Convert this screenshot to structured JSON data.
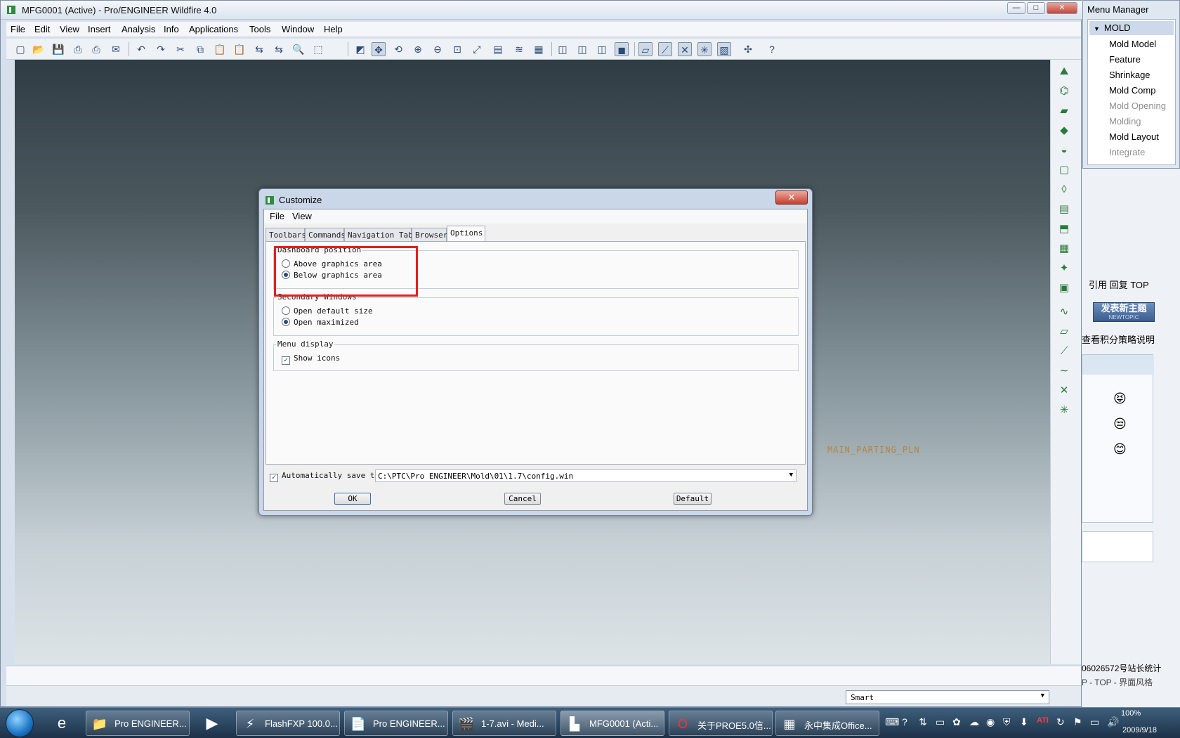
{
  "window": {
    "title": "MFG0001 (Active) - Pro/ENGINEER Wildfire 4.0",
    "controls": [
      "—",
      "□",
      "✕"
    ]
  },
  "menubar": [
    "File",
    "Edit",
    "View",
    "Insert",
    "Analysis",
    "Info",
    "Applications",
    "Tools",
    "Window",
    "Help"
  ],
  "toolbar_icons": [
    "new-icon",
    "open-icon",
    "save-icon",
    "print-icon",
    "quick-print-icon",
    "send-icon",
    "undo-icon",
    "redo-icon",
    "cut-icon",
    "copy-icon",
    "paste-icon",
    "paste-special-icon",
    "regenerate-icon",
    "regen-manager-icon",
    "find-icon",
    "select-box-icon",
    "repaint-icon",
    "spin-center-icon",
    "orient-icon",
    "zoom-in-icon",
    "zoom-out-icon",
    "refit-icon",
    "reorient-icon",
    "saved-views-icon",
    "layers-icon",
    "view-manager-icon",
    "wireframe-icon",
    "hidden-line-icon",
    "no-hidden-icon",
    "shading-icon",
    "datum-planes-icon",
    "datum-axes-icon",
    "datum-points-icon",
    "coord-sys-icon",
    "annotations-icon",
    "spin-center-toggle-icon",
    "context-help-icon"
  ],
  "graphics": {
    "datum_label": "MAIN_PARTING_PLN"
  },
  "right_toolbar_icons": [
    "mold-volume-icon",
    "parting-surface-icon",
    "extrude-icon",
    "sweep-icon",
    "revolve-icon",
    "datum-plane-icon",
    "sketch-icon",
    "split-icon",
    "cavity-icon",
    "trim-icon",
    "merge-icon",
    "waterline-icon",
    "plane-icon",
    "axis-icon",
    "curve-icon",
    "point-icon",
    "csys-icon",
    "analysis-icon"
  ],
  "menu_manager": {
    "title": "Menu Manager",
    "header": "MOLD",
    "items": [
      {
        "label": "Mold Model",
        "enabled": true
      },
      {
        "label": "Feature",
        "enabled": true
      },
      {
        "label": "Shrinkage",
        "enabled": true
      },
      {
        "label": "Mold Comp",
        "enabled": true
      },
      {
        "label": "Mold Opening",
        "enabled": false
      },
      {
        "label": "Molding",
        "enabled": false
      },
      {
        "label": "Mold Layout",
        "enabled": true
      },
      {
        "label": "Integrate",
        "enabled": false
      }
    ]
  },
  "background_page": {
    "reply_links": "引用 回复 TOP",
    "new_topic_button": "发表新主题",
    "new_topic_sub": "NEWTOPIC",
    "points_link": "查看积分策略说明",
    "site_stats": "06026572号站长统计",
    "style_bar": "P - TOP - 界面风格"
  },
  "dialog": {
    "title": "Customize",
    "close": "✕",
    "menus": [
      "File",
      "View"
    ],
    "tabs": [
      "Toolbars",
      "Commands",
      "Navigation Tabs",
      "Browser",
      "Options"
    ],
    "active_tab": "Options",
    "groups": {
      "dashboard": {
        "label": "Dashboard position",
        "options": [
          {
            "label": "Above graphics area",
            "selected": false
          },
          {
            "label": "Below graphics area",
            "selected": true
          }
        ]
      },
      "secondary": {
        "label": "Secondary Windows",
        "options": [
          {
            "label": "Open default size",
            "selected": false
          },
          {
            "label": "Open maximized",
            "selected": true
          }
        ]
      },
      "menu_display": {
        "label": "Menu display",
        "show_icons_label": "Show icons",
        "show_icons_checked": true
      }
    },
    "autosave": {
      "label": "Automatically save to",
      "checked": true,
      "path": "C:\\PTC\\Pro ENGINEER\\Mold\\01\\1.7\\config.win"
    },
    "buttons": {
      "ok": "OK",
      "cancel": "Cancel",
      "default": "Default"
    }
  },
  "status": {
    "filter_value": "Smart"
  },
  "taskbar": {
    "tasks": [
      {
        "label": "Pro ENGINEER...",
        "icon": "folder-icon"
      },
      {
        "label": "FlashFXP 100.0...",
        "icon": "flashfxp-icon"
      },
      {
        "label": "Pro ENGINEER...",
        "icon": "pdf-icon"
      },
      {
        "label": "1-7.avi - Medi...",
        "icon": "media-player-icon"
      },
      {
        "label": "MFG0001 (Acti...",
        "icon": "proe-icon"
      },
      {
        "label": "关于PROE5.0信...",
        "icon": "opera-icon"
      },
      {
        "label": "永中集成Office...",
        "icon": "office-icon"
      }
    ],
    "zoom": "100%",
    "date": "2009/9/18"
  }
}
